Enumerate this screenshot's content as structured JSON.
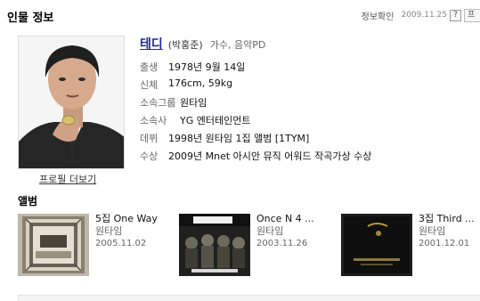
{
  "header": {
    "title": "인물 정보",
    "verify_link": "정보확인",
    "date": "2009.11.25",
    "help_label": "?",
    "next_label": "프"
  },
  "profile": {
    "name": "테디",
    "real_name": "(박홍준)",
    "jobs": "가수, 음악PD",
    "more_link": "프로필 더보기",
    "info": [
      {
        "label": "출생",
        "value": "1978년 9월 14일"
      },
      {
        "label": "신체",
        "value": "176cm, 59kg"
      },
      {
        "label": "소속그룹",
        "value": "원타임"
      },
      {
        "label": "소속사",
        "value": "YG 엔터테인먼트"
      },
      {
        "label": "데뷔",
        "value": "1998년 원타임 1집 앨범 [1TYM]"
      },
      {
        "label": "수상",
        "value": "2009년 Mnet 아시안 뮤직 어워드 작곡가상 수상"
      }
    ]
  },
  "albums": {
    "heading": "앨범",
    "items": [
      {
        "title": "5집 One Way",
        "artist": "원타임",
        "date": "2005.11.02"
      },
      {
        "title": "Once N 4 ...",
        "artist": "원타임",
        "date": "2003.11.26"
      },
      {
        "title": "3집 Third ...",
        "artist": "원타임",
        "date": "2001.12.01"
      }
    ]
  },
  "colors": {
    "name_link": "#1d2d9a",
    "label_gray": "#666666"
  }
}
